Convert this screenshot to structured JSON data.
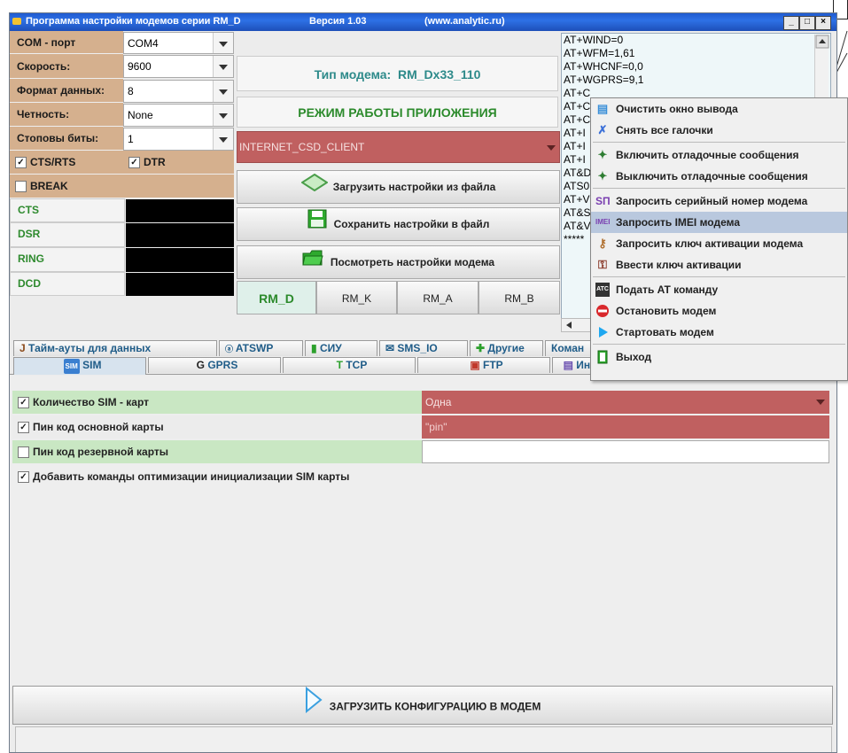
{
  "window": {
    "title": "Программа настройки модемов серии RM_D",
    "version": "Версия 1.03",
    "url": "(www.analytic.ru)",
    "minimize": "_",
    "maximize": "□",
    "close": "×"
  },
  "config": {
    "com_label": "COM - порт",
    "com_value": "COM4",
    "speed_label": "Скорость:",
    "speed_value": "9600",
    "format_label": "Формат данных:",
    "format_value": "8",
    "parity_label": "Четность:",
    "parity_value": "None",
    "stop_label": "Стоповы биты:",
    "stop_value": "1",
    "cts_rts": "CTS/RTS",
    "dtr": "DTR",
    "break": "BREAK",
    "signals": [
      "CTS",
      "DSR",
      "RING",
      "DCD"
    ]
  },
  "modem": {
    "type_prefix": "Тип модема:",
    "type_value": "RM_Dx33_110",
    "mode_title": "РЕЖИМ РАБОТЫ ПРИЛОЖЕНИЯ",
    "mode_value": "INTERNET_CSD_CLIENT",
    "load_button": "Загрузить настройки из файла",
    "save_button": "Сохранить настройки в файл",
    "view_button": "Посмотреть настройки модема",
    "models": [
      "RM_D",
      "RM_K",
      "RM_A",
      "RM_B"
    ]
  },
  "terminal": {
    "lines": [
      "AT+WIND=0",
      "AT+WFM=1,61",
      "AT+WHCNF=0,0",
      "AT+WGPRS=9,1",
      "AT+C",
      "AT+C",
      "AT+C",
      "AT+I",
      "AT+I",
      "AT+I",
      "AT&D",
      "ATS0",
      "AT+V",
      "AT&S",
      "AT&V",
      "*****"
    ]
  },
  "tabs_row1": [
    "Тайм-ауты для данных",
    "ATSWP",
    "СИУ",
    "SMS_IO",
    "Другие",
    "Коман"
  ],
  "tabs_row2": [
    "SIM",
    "GPRS",
    "TCP",
    "FTP",
    "Инт"
  ],
  "sim": {
    "count_label": "Количество SIM - карт",
    "count_value": "Одна",
    "pin_main_label": "Пин код основной карты",
    "pin_main_value": "\"pin\"",
    "pin_reserve_label": "Пин код резервной карты",
    "optimize_label": "Добавить команды оптимизации инициализации SIM карты"
  },
  "upload_button": "ЗАГРУЗИТЬ КОНФИГУРАЦИЮ В МОДЕМ",
  "menu": {
    "items": [
      "Очистить окно вывода",
      "Снять все галочки",
      "Включить отладочные сообщения",
      "Выключить отладочные сообщения",
      "Запросить серийный номер модема",
      "Запросить IMEI модема",
      "Запросить ключ активации модема",
      "Ввести ключ активации",
      "Подать AT команду",
      "Остановить модем",
      "Стартовать модем",
      "Выход"
    ],
    "icon_serial": "SП",
    "icon_imei": "IMEI",
    "icon_at": "ATC"
  },
  "colors": {
    "accent": "#2e71e6",
    "label_bg": "#d5b08e",
    "danger_field": "#c06060",
    "green_row": "#c9e7c3"
  }
}
